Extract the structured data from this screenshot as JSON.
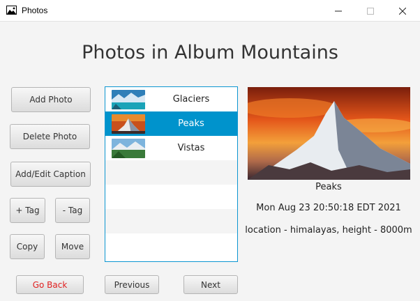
{
  "window": {
    "title": "Photos"
  },
  "heading": "Photos in Album Mountains",
  "buttons": {
    "add_photo": "Add Photo",
    "delete_photo": "Delete Photo",
    "add_edit_caption": "Add/Edit Caption",
    "add_tag": "+ Tag",
    "remove_tag": "- Tag",
    "copy": "Copy",
    "move": "Move",
    "go_back": "Go Back",
    "previous": "Previous",
    "next": "Next"
  },
  "photos": [
    {
      "caption": "Glaciers",
      "selected": false
    },
    {
      "caption": "Peaks",
      "selected": true
    },
    {
      "caption": "Vistas",
      "selected": false
    }
  ],
  "details": {
    "caption": "Peaks",
    "date": "Mon Aug 23 20:50:18 EDT 2021",
    "tags": "location - himalayas, height - 8000m"
  },
  "colors": {
    "accent": "#0093cc",
    "danger": "#e02020"
  }
}
